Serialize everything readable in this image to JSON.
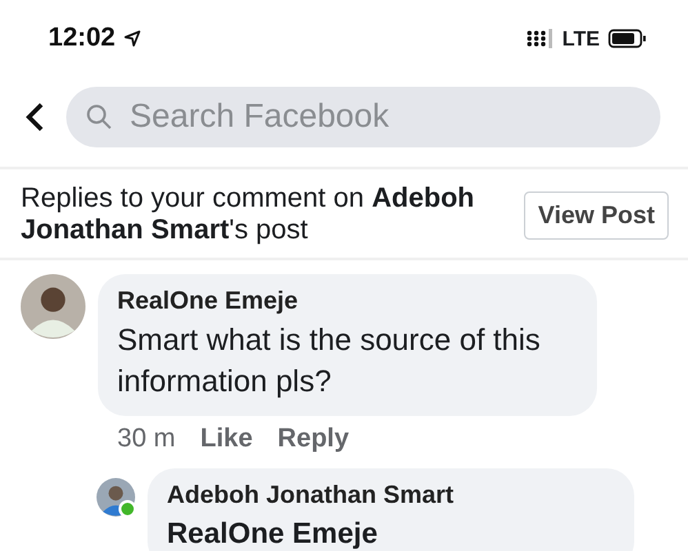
{
  "status_bar": {
    "time": "12:02",
    "network": "LTE"
  },
  "search": {
    "placeholder": "Search Facebook"
  },
  "header": {
    "text": "Replies to your comment on **Adeboh Jonathan Smart**'s post",
    "button": "View Post"
  },
  "comments": [
    {
      "author": "RealOne Emeje",
      "text": "Smart what is the source of this information pls?",
      "time": "30 m",
      "actions": [
        "Like",
        "Reply"
      ],
      "online": false,
      "reply": false
    },
    {
      "author": "Adeboh Jonathan Smart",
      "text": "RealOne Emeje",
      "online": true,
      "reply": true
    }
  ]
}
